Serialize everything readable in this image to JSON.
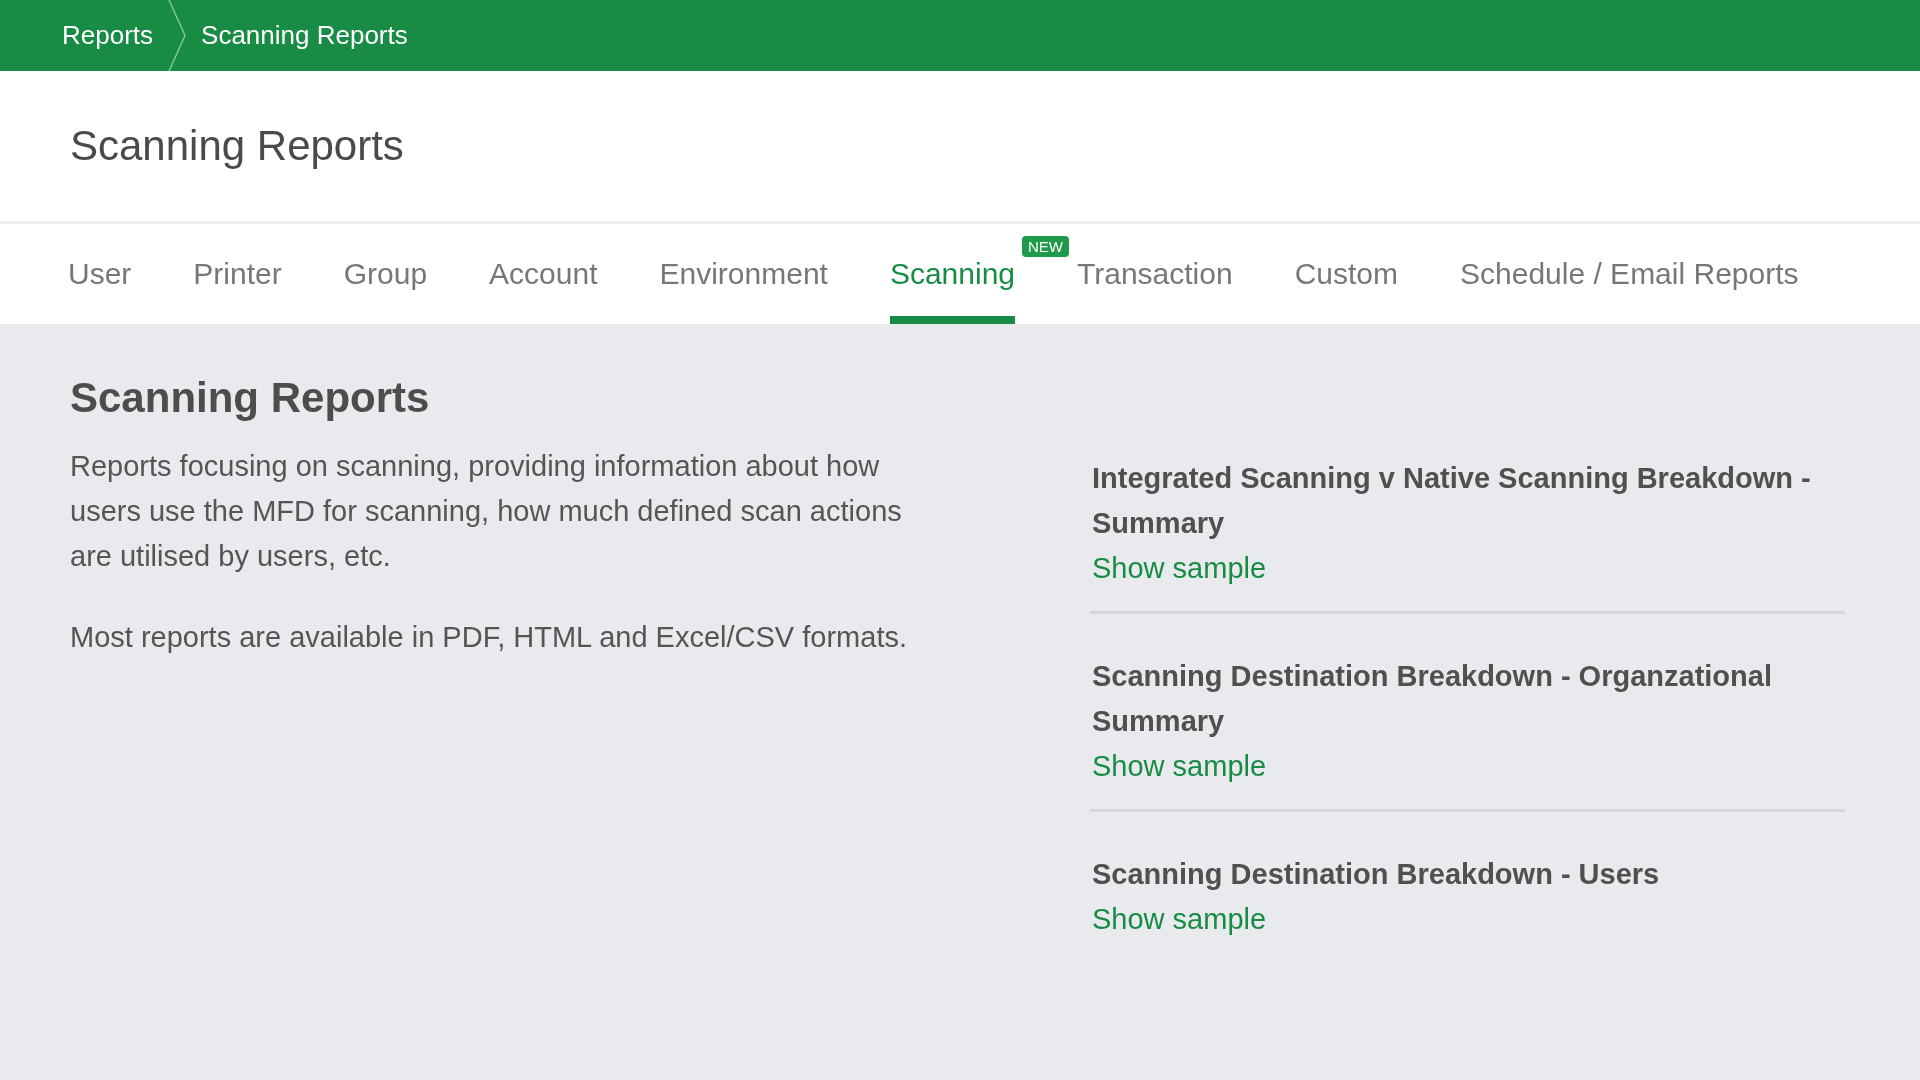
{
  "breadcrumb": [
    "Reports",
    "Scanning Reports"
  ],
  "page_title": "Scanning Reports",
  "tabs": [
    {
      "label": "User",
      "selected": false
    },
    {
      "label": "Printer",
      "selected": false
    },
    {
      "label": "Group",
      "selected": false
    },
    {
      "label": "Account",
      "selected": false
    },
    {
      "label": "Environment",
      "selected": false
    },
    {
      "label": "Scanning",
      "selected": true,
      "badge": "NEW"
    },
    {
      "label": "Transaction",
      "selected": false
    },
    {
      "label": "Custom",
      "selected": false
    },
    {
      "label": "Schedule / Email Reports",
      "selected": false
    }
  ],
  "section": {
    "title": "Scanning Reports",
    "paragraphs": [
      "Reports focusing on scanning, providing information about how users use the MFD for scanning, how much defined scan actions are utilised by users, etc.",
      "Most reports are available in PDF, HTML and Excel/CSV formats."
    ]
  },
  "reports": [
    {
      "title": "Integrated Scanning v Native Scanning Breakdown - Summary",
      "link": "Show sample"
    },
    {
      "title": "Scanning Destination Breakdown - Organzational Summary",
      "link": "Show sample"
    },
    {
      "title": "Scanning Destination Breakdown - Users",
      "link": "Show sample"
    }
  ]
}
